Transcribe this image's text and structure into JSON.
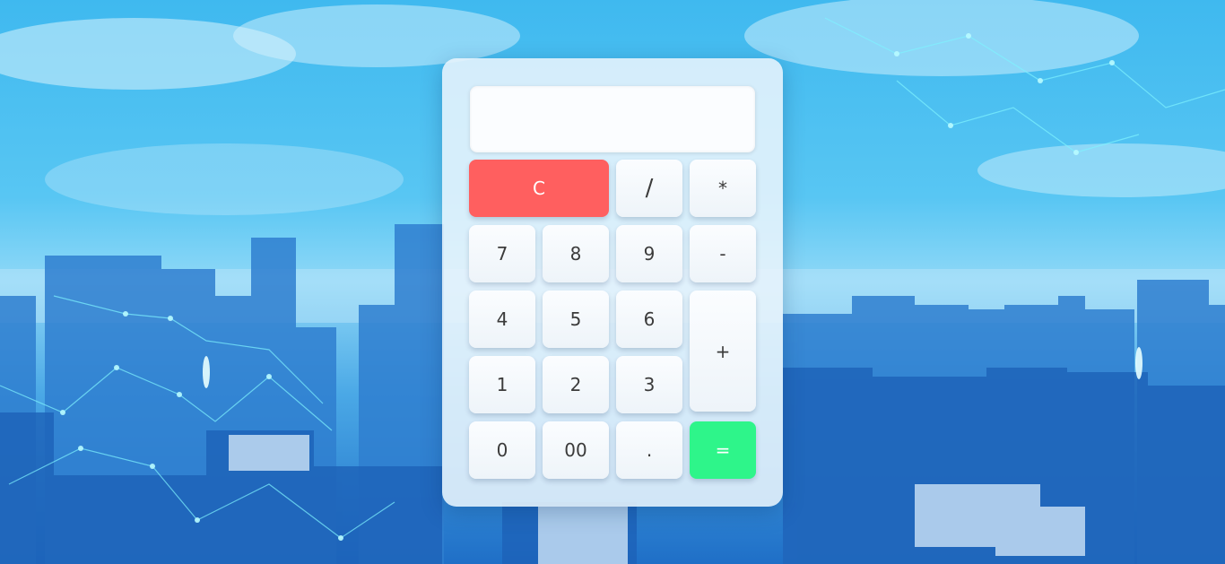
{
  "colors": {
    "clear_button": "#ff5f5f",
    "equals_button": "#2ef58a",
    "panel": "#e8f4fc",
    "key": "#fbfdff"
  },
  "display": {
    "value": ""
  },
  "keys": {
    "clear": "C",
    "divide": "/",
    "multiply": "*",
    "seven": "7",
    "eight": "8",
    "nine": "9",
    "minus": "-",
    "four": "4",
    "five": "5",
    "six": "6",
    "plus": "+",
    "one": "1",
    "two": "2",
    "three": "3",
    "zero": "0",
    "double_zero": "00",
    "decimal": ".",
    "equals": "="
  }
}
